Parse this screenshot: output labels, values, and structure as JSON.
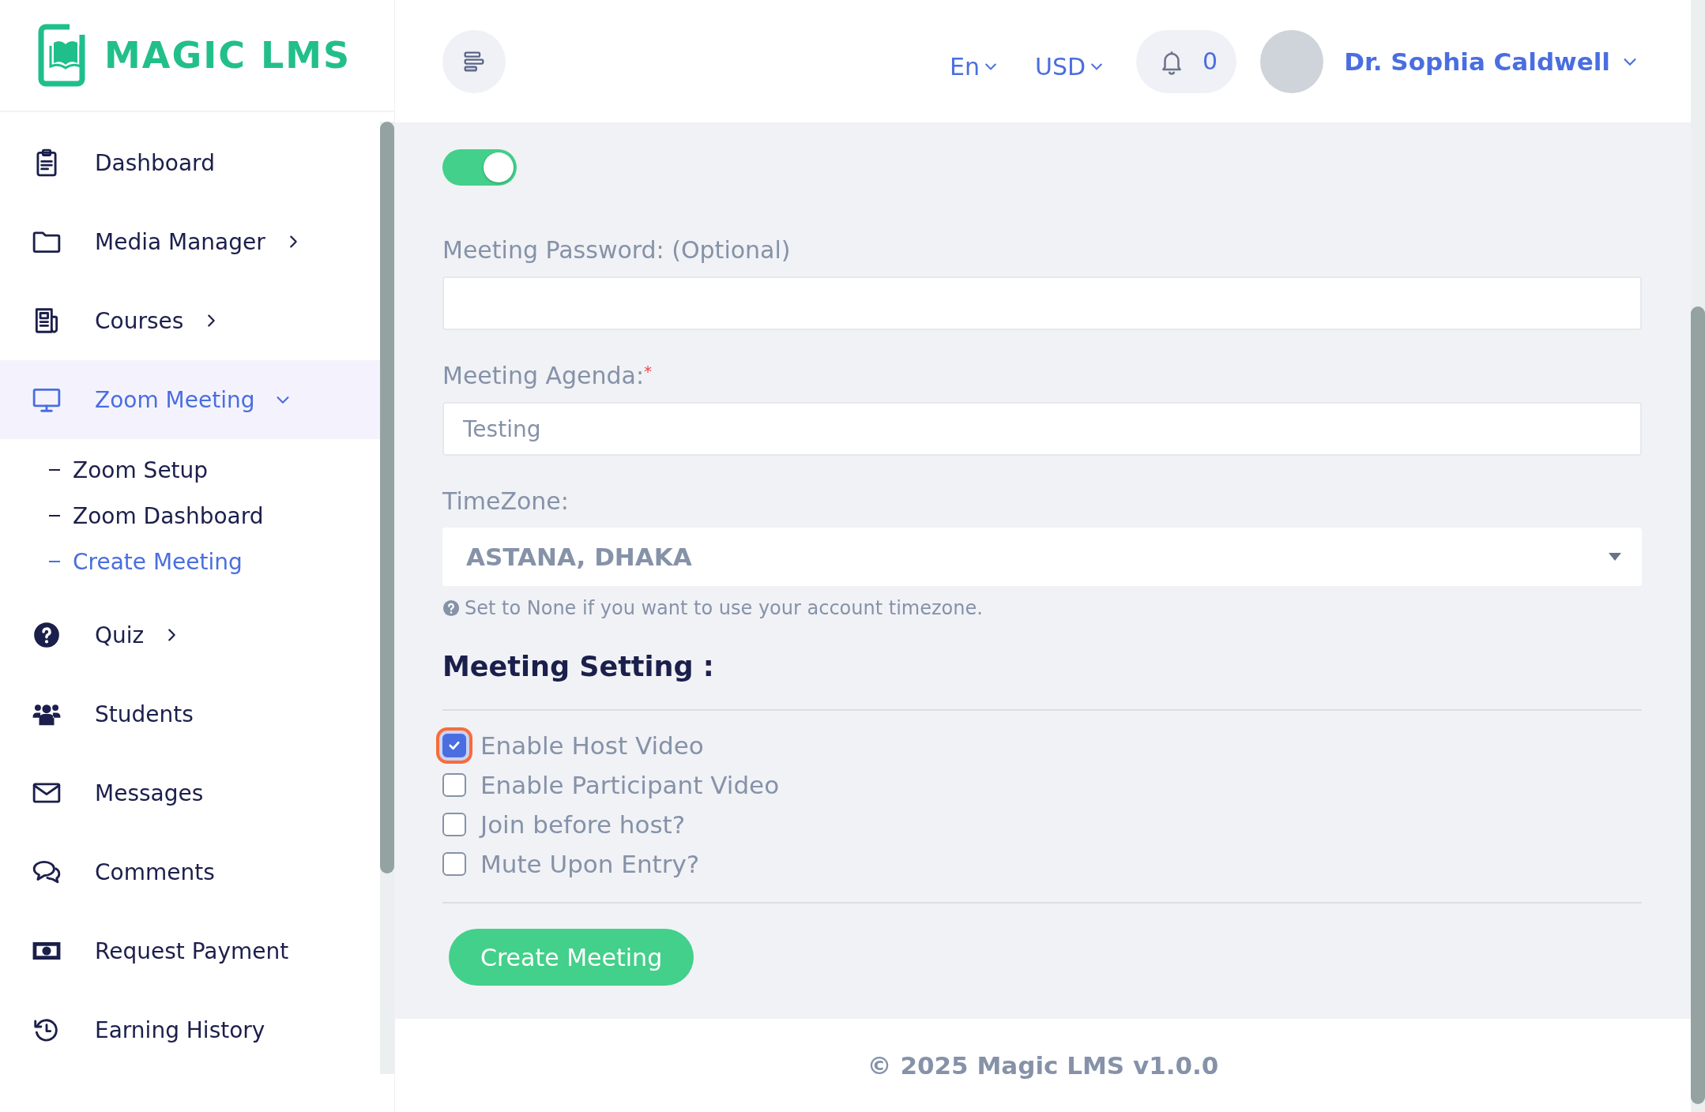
{
  "logo": {
    "text": "MAGIC LMS"
  },
  "header": {
    "language": "En",
    "currency": "USD",
    "notifications": "0",
    "user_name": "Dr. Sophia Caldwell"
  },
  "sidebar": {
    "items": [
      {
        "label": "Dashboard",
        "selected": false
      },
      {
        "label": "Media Manager",
        "selected": false,
        "expanded": false
      },
      {
        "label": "Courses",
        "selected": false,
        "expanded": false
      },
      {
        "label": "Zoom Meeting",
        "selected": true,
        "expanded": true,
        "children": [
          {
            "label": "Zoom Setup",
            "selected": false
          },
          {
            "label": "Zoom Dashboard",
            "selected": false
          },
          {
            "label": "Create Meeting",
            "selected": true
          }
        ]
      },
      {
        "label": "Quiz",
        "selected": false,
        "expanded": false
      },
      {
        "label": "Students",
        "selected": false
      },
      {
        "label": "Messages",
        "selected": false
      },
      {
        "label": "Comments",
        "selected": false
      },
      {
        "label": "Request Payment",
        "selected": false
      },
      {
        "label": "Earning History",
        "selected": false
      }
    ]
  },
  "form": {
    "recurring_toggle": {
      "on": true
    },
    "password": {
      "label": "Meeting Password: (Optional)"
    },
    "agenda": {
      "label": "Meeting Agenda:",
      "required_mark": "*",
      "value": "Testing"
    },
    "timezone": {
      "label": "TimeZone:",
      "value": "ASTANA, DHAKA",
      "help": "Set to None if you want to use your account timezone."
    },
    "settings_heading": "Meeting Setting :",
    "settings": [
      {
        "label": "Enable Host Video",
        "checked": true,
        "focused": true
      },
      {
        "label": "Enable Participant Video",
        "checked": false,
        "focused": false
      },
      {
        "label": "Join before host?",
        "checked": false,
        "focused": false
      },
      {
        "label": "Mute Upon Entry?",
        "checked": false,
        "focused": false
      }
    ],
    "submit": "Create Meeting"
  },
  "footer": "© 2025 Magic LMS v1.0.0"
}
